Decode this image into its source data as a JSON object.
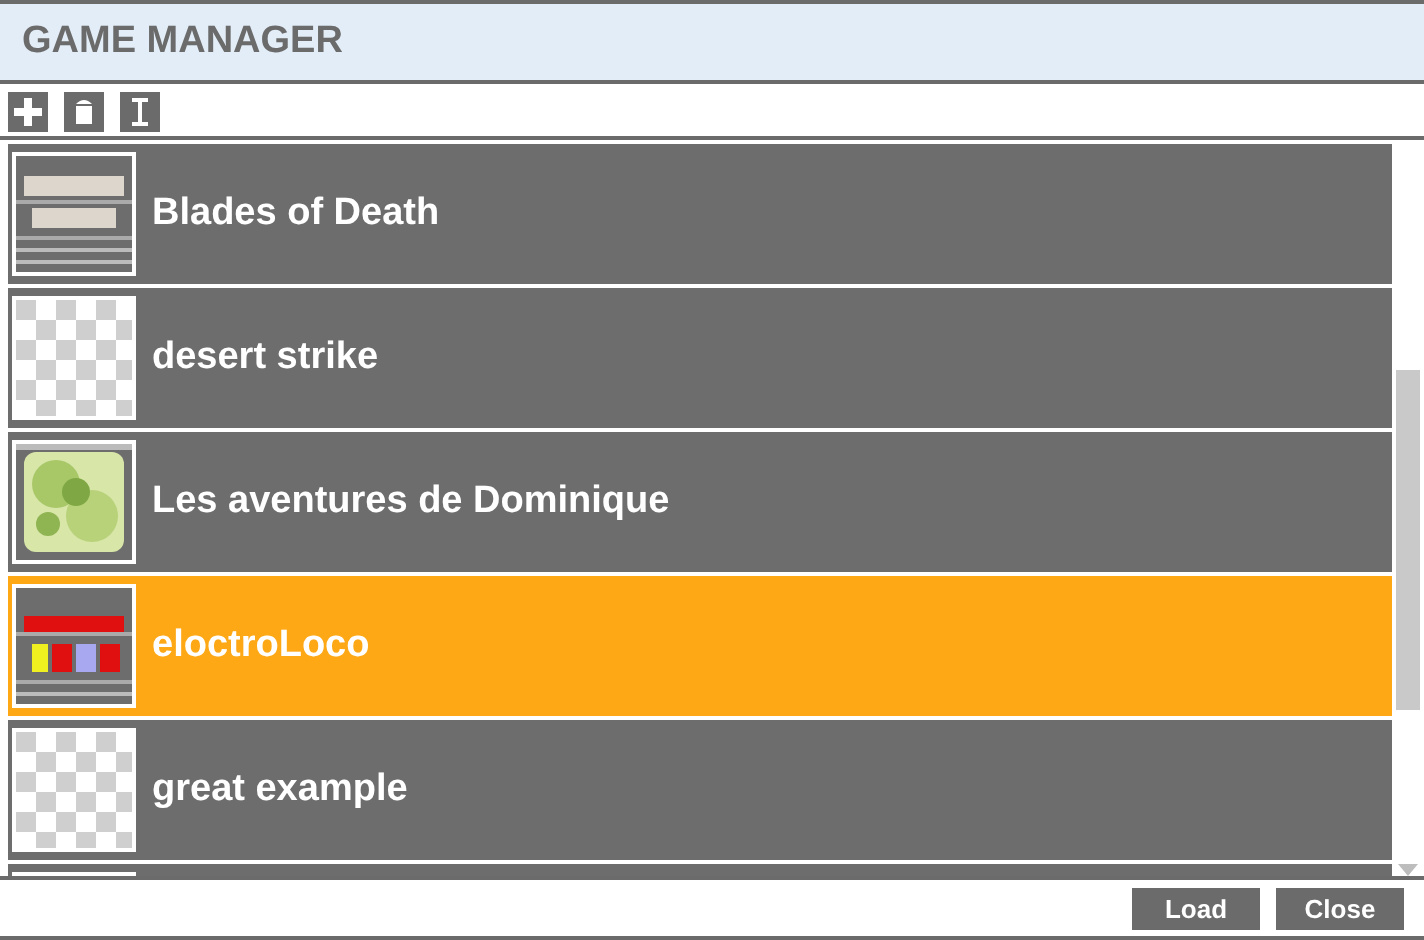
{
  "window": {
    "title": "GAME MANAGER"
  },
  "toolbar": [
    {
      "kind": "add"
    },
    {
      "kind": "delete"
    },
    {
      "kind": "rename"
    }
  ],
  "games": [
    {
      "title": "Blades of Death",
      "kind": "picture",
      "selected": false
    },
    {
      "title": "desert strike",
      "kind": "placeholder",
      "selected": false
    },
    {
      "title": "Les aventures de Dominique",
      "kind": "picture",
      "selected": false
    },
    {
      "title": "eloctroLoco",
      "kind": "picture",
      "selected": true
    },
    {
      "title": "great example",
      "kind": "placeholder",
      "selected": false
    },
    {
      "selected": false
    }
  ],
  "buttons": [
    {
      "label": "Load"
    },
    {
      "label": "Close"
    }
  ]
}
